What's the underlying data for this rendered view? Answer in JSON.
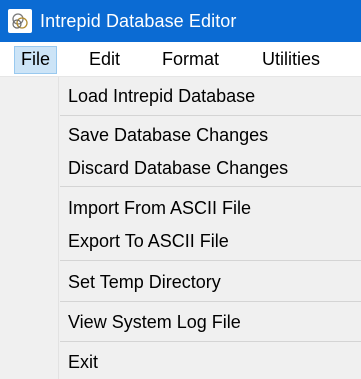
{
  "window": {
    "title": "Intrepid Database Editor",
    "icon": "intrepid-app-icon"
  },
  "menubar": {
    "items": [
      {
        "label": "File"
      },
      {
        "label": "Edit"
      },
      {
        "label": "Format"
      },
      {
        "label": "Utilities"
      }
    ],
    "active": "File"
  },
  "file_menu": {
    "items": [
      {
        "label": "Load Intrepid Database"
      },
      {
        "label": "Save Database Changes"
      },
      {
        "label": "Discard Database Changes"
      },
      {
        "label": "Import From ASCII File"
      },
      {
        "label": "Export To ASCII File"
      },
      {
        "label": "Set Temp Directory"
      },
      {
        "label": "View System Log File"
      },
      {
        "label": "Exit"
      }
    ]
  },
  "colors": {
    "titlebar": "#0b6bd3",
    "menu_highlight": "#cce4f7",
    "menu_highlight_border": "#99c9ef",
    "dropdown_bg": "#f0f0f0"
  }
}
